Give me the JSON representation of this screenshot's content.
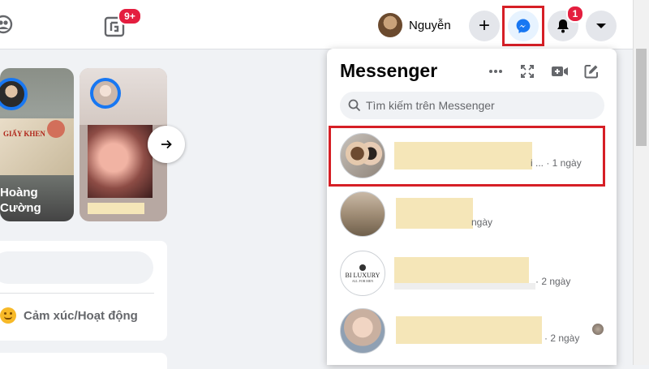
{
  "topbar": {
    "groups_badge": "9+",
    "user_name": "Nguyễn",
    "notification_badge": "1"
  },
  "stories": {
    "story1_name_line1": "Hoàng",
    "story1_name_line2": "Cường",
    "story1_card_text": "GIẤY KHEN"
  },
  "composer": {
    "feeling_label": "Cảm xúc/Hoạt động"
  },
  "messenger": {
    "title": "Messenger",
    "search_placeholder": "Tìm kiếm trên Messenger",
    "conversations": [
      {
        "snippet": "i ... · 1 ngày"
      },
      {
        "snippet": "ngày"
      },
      {
        "snippet": "· 2 ngày",
        "logo_text": "BI LUXURY",
        "logo_sub": "ALL FOR MEN"
      },
      {
        "snippet": "· 2 ngày"
      }
    ]
  },
  "colors": {
    "accent": "#1877f2",
    "highlight": "#d61f26",
    "badge": "#e41e3f"
  }
}
